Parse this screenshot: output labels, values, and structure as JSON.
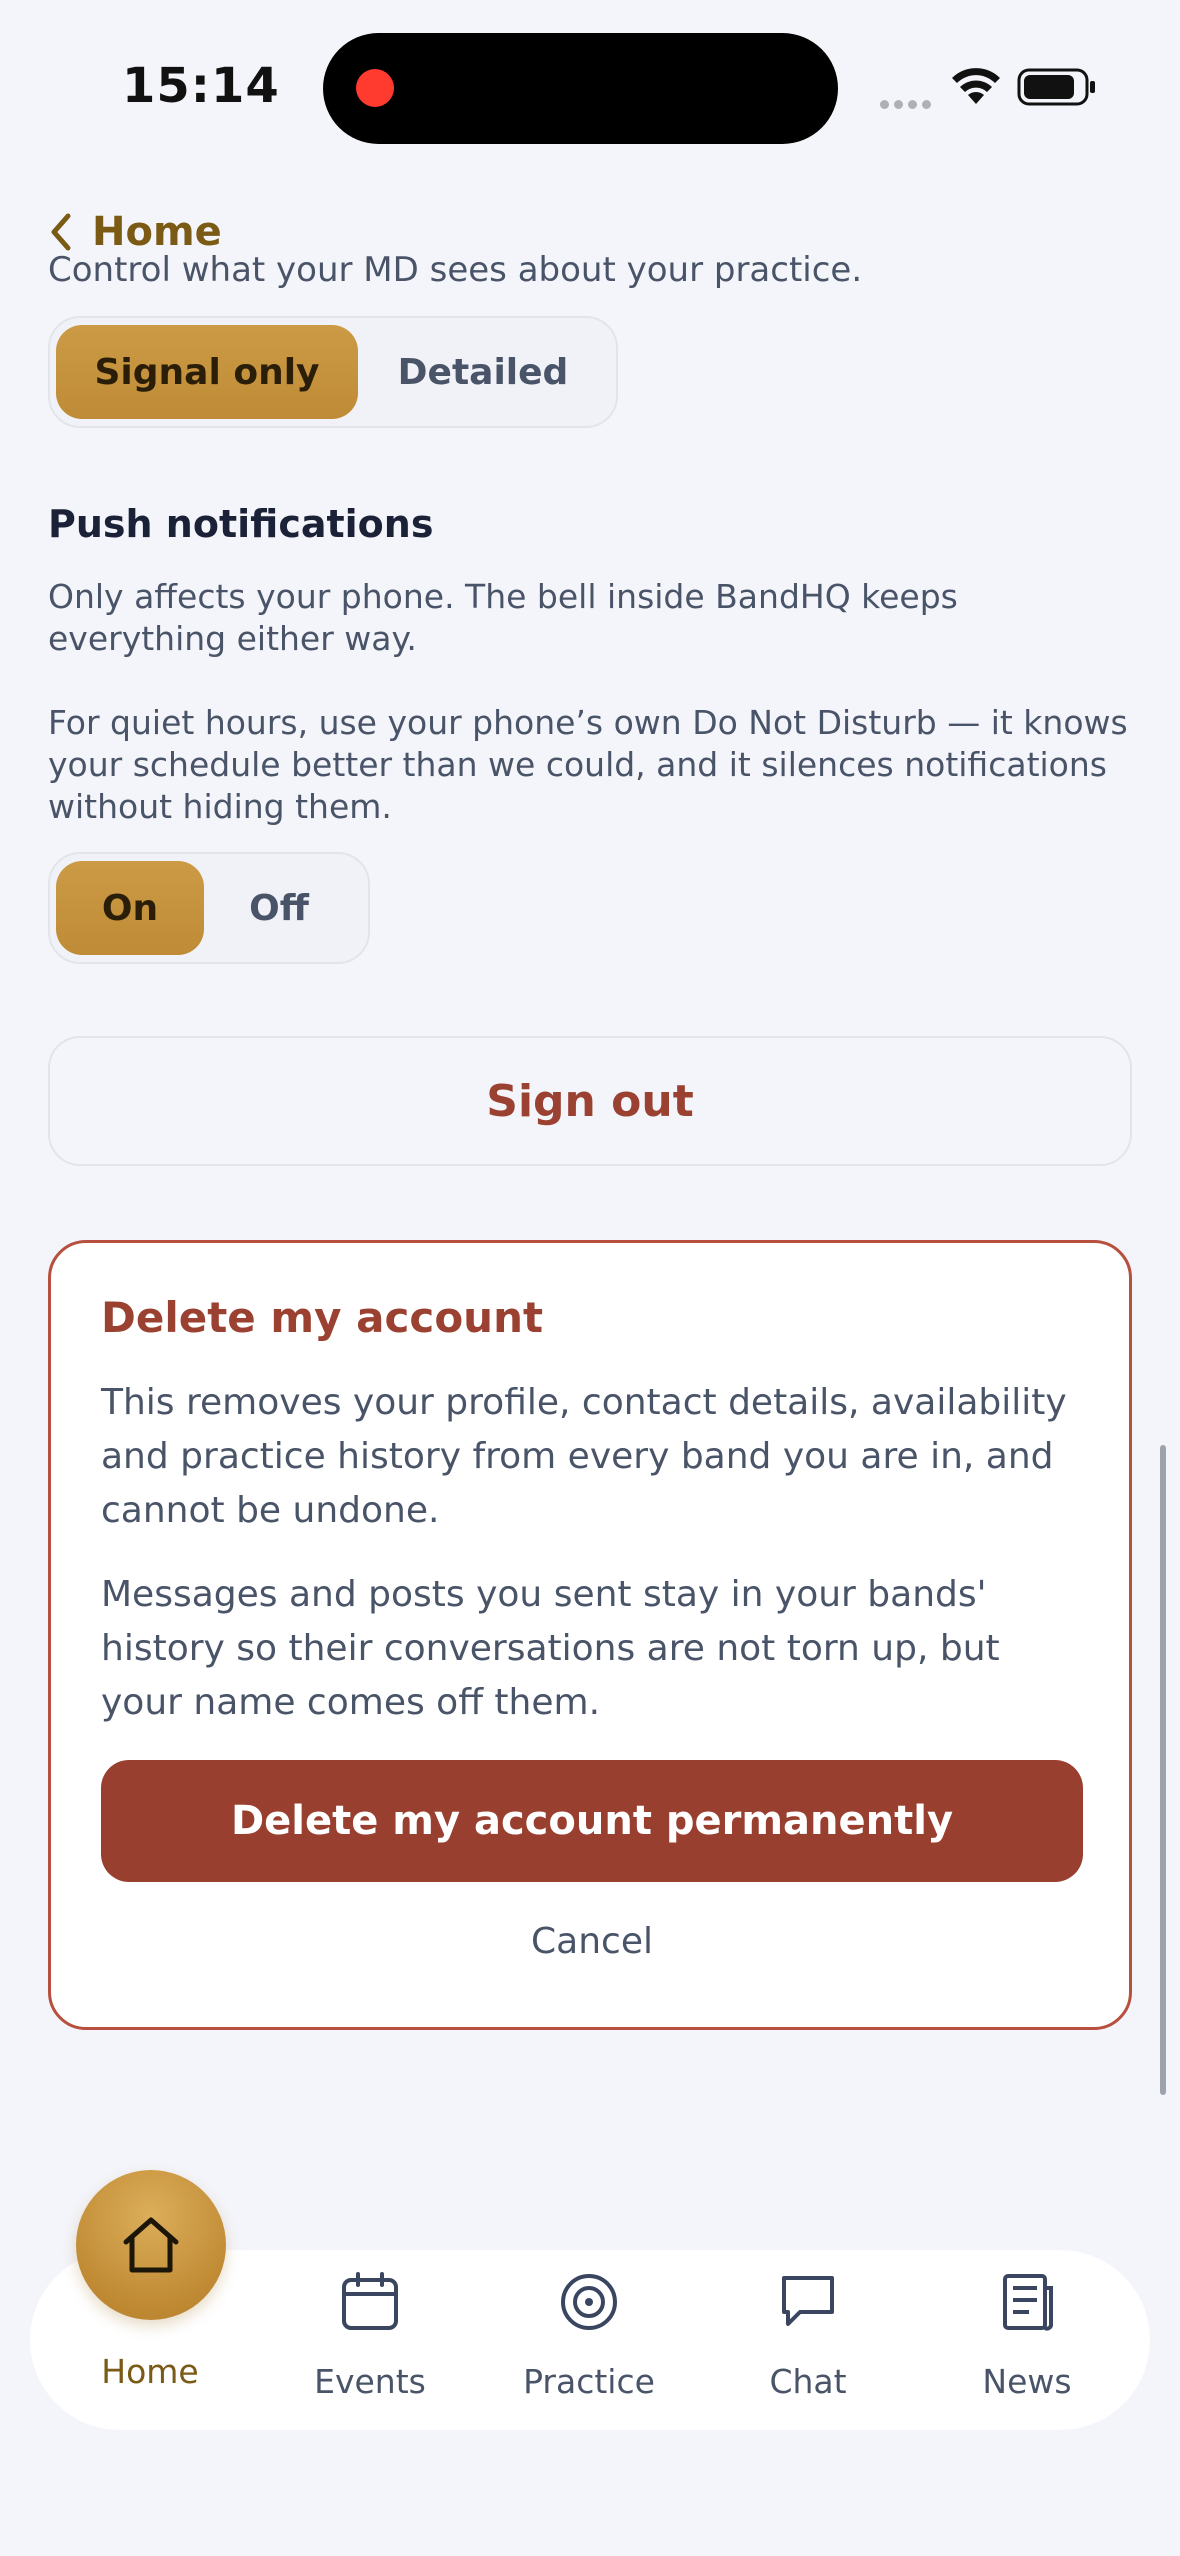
{
  "status_bar": {
    "time": "15:14"
  },
  "nav": {
    "back_label": "Home"
  },
  "md_visibility": {
    "description": "Control what your MD sees about your practice.",
    "options": [
      "Signal only",
      "Detailed"
    ],
    "selected": "Signal only"
  },
  "push": {
    "title": "Push notifications",
    "desc1": "Only affects your phone. The bell inside BandHQ keeps everything either way.",
    "desc2": "For quiet hours, use your phone’s own Do Not Disturb — it knows your schedule better than we could, and it silences notifications without hiding them.",
    "options": [
      "On",
      "Off"
    ],
    "selected": "On"
  },
  "sign_out_label": "Sign out",
  "delete": {
    "title": "Delete my account",
    "p1": "This removes your profile, contact details, availability and practice history from every band you are in, and cannot be undone.",
    "p2": "Messages and posts you sent stay in your bands' history so their conversations are not torn up, but your name comes off them.",
    "confirm_label": "Delete my account permanently",
    "cancel_label": "Cancel"
  },
  "tabs": [
    {
      "label": "Home",
      "icon": "home-icon",
      "active": true
    },
    {
      "label": "Events",
      "icon": "calendar-icon",
      "active": false
    },
    {
      "label": "Practice",
      "icon": "target-icon",
      "active": false
    },
    {
      "label": "Chat",
      "icon": "chat-bubble-icon",
      "active": false
    },
    {
      "label": "News",
      "icon": "newspaper-icon",
      "active": false
    }
  ],
  "colors": {
    "accent_gold": "#C6923C",
    "danger_red": "#993F2F",
    "background": "#F4F5FA"
  }
}
